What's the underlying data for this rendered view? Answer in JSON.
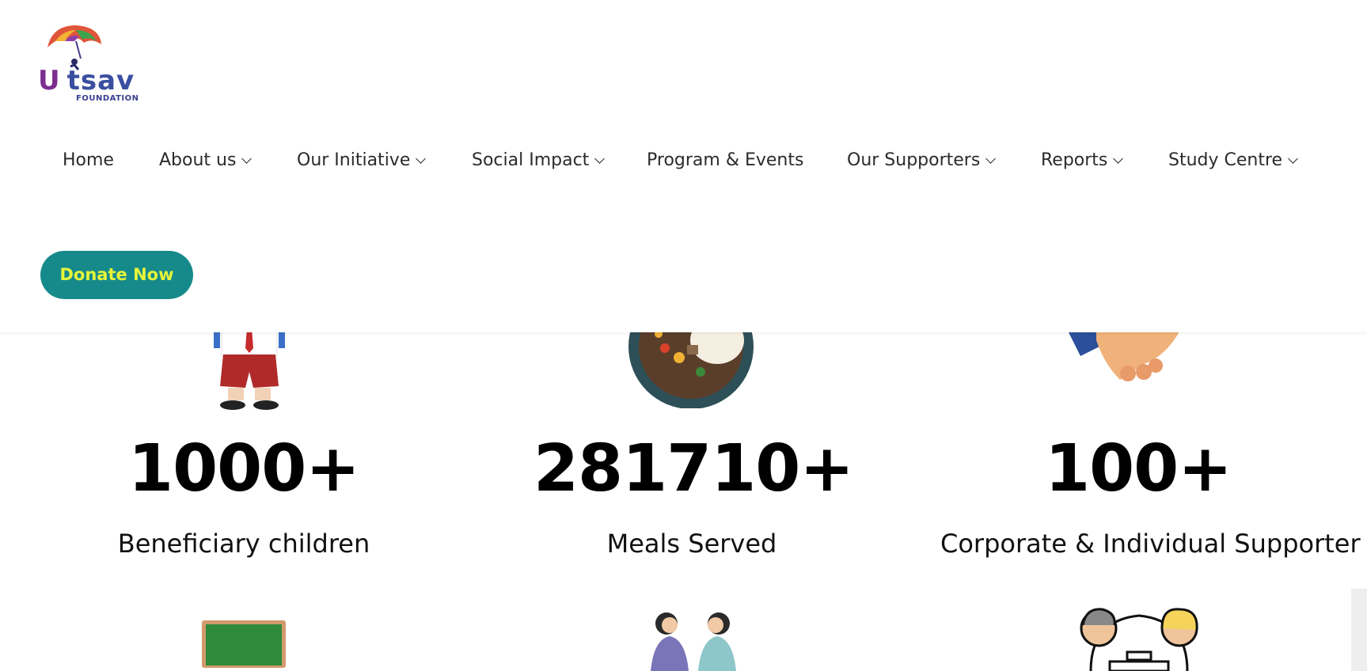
{
  "logo": {
    "word_part1": "U",
    "word_part2": "tsav",
    "subtitle": "FOUNDATION"
  },
  "nav": {
    "items": [
      {
        "label": "Home",
        "dropdown": false
      },
      {
        "label": "About us",
        "dropdown": true
      },
      {
        "label": "Our Initiative",
        "dropdown": true
      },
      {
        "label": "Social Impact",
        "dropdown": true
      },
      {
        "label": "Program & Events",
        "dropdown": false
      },
      {
        "label": "Our Supporters",
        "dropdown": true
      },
      {
        "label": "Reports",
        "dropdown": true
      },
      {
        "label": "Study Centre",
        "dropdown": true
      }
    ]
  },
  "donate": {
    "label": "Donate Now"
  },
  "stats": [
    {
      "value": "1000+",
      "label": "Beneficiary children",
      "icon": "schoolboy-icon"
    },
    {
      "value": "281710+",
      "label": "Meals Served",
      "icon": "meal-plate-icon"
    },
    {
      "value": "100+",
      "label": "Corporate & Individual Supporter",
      "icon": "handshake-icon"
    }
  ],
  "next_row_icons": [
    "chalkboard-icon",
    "women-talking-icon",
    "meeting-people-icon"
  ],
  "colors": {
    "brand_teal": "#168a8a",
    "donate_text": "#e6f43a",
    "text_dark": "#2b2b2b"
  }
}
